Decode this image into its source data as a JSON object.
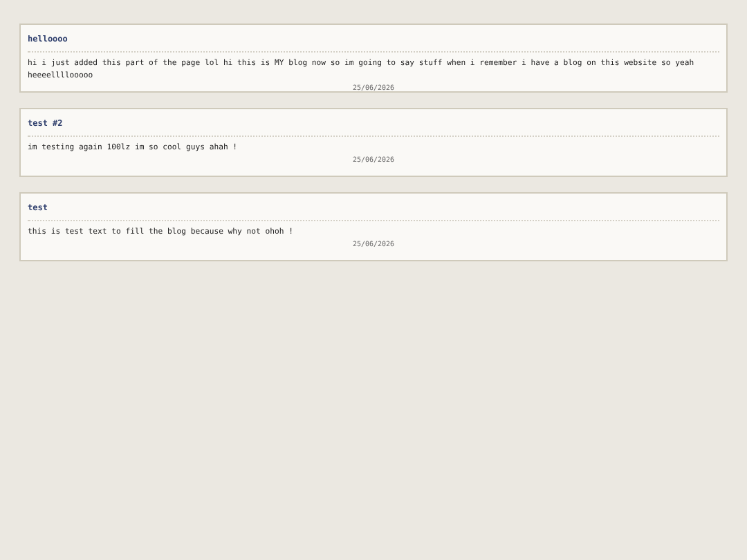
{
  "posts": [
    {
      "title": "helloooo",
      "body": "hi i just added this part of the page lol hi this is MY blog now so im going to say stuff when i remember i have a blog on this website so yeah heeeellllooooo",
      "date": "25/06/2026"
    },
    {
      "title": "test #2",
      "body": "im testing again 100lz im so cool guys ahah !",
      "date": "25/06/2026"
    },
    {
      "title": "test",
      "body": "this is test text to fill the blog because why not ohoh !",
      "date": "25/06/2026"
    }
  ]
}
